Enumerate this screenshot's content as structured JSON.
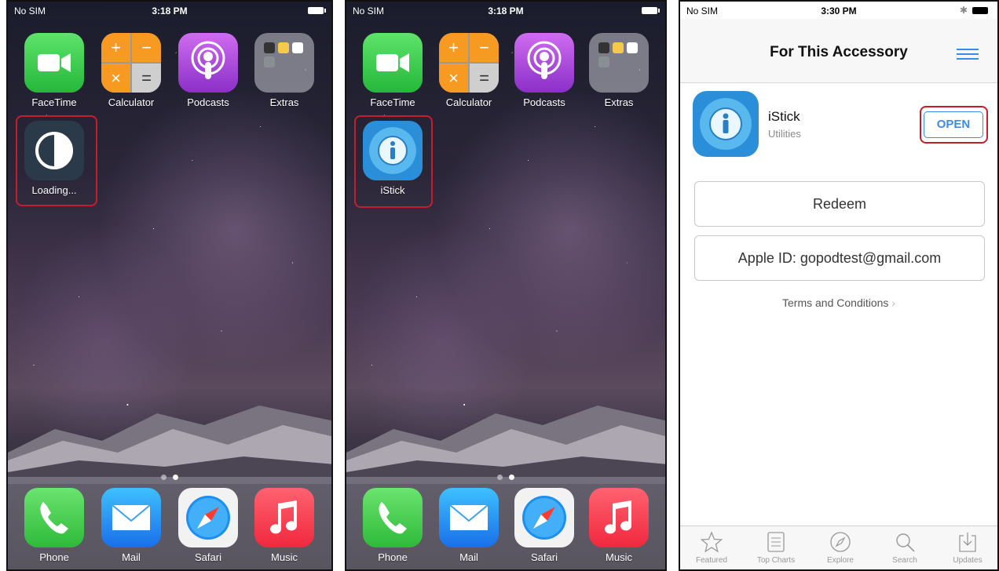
{
  "panel1": {
    "status": {
      "carrier": "No SIM",
      "time": "3:18 PM"
    },
    "apps": [
      {
        "label": "FaceTime"
      },
      {
        "label": "Calculator"
      },
      {
        "label": "Podcasts"
      },
      {
        "label": "Extras"
      }
    ],
    "installing_app": {
      "label": "Loading..."
    },
    "dock": [
      {
        "label": "Phone"
      },
      {
        "label": "Mail"
      },
      {
        "label": "Safari"
      },
      {
        "label": "Music"
      }
    ],
    "page_count": 2,
    "current_page": 2
  },
  "panel2": {
    "status": {
      "carrier": "No SIM",
      "time": "3:18 PM"
    },
    "apps": [
      {
        "label": "FaceTime"
      },
      {
        "label": "Calculator"
      },
      {
        "label": "Podcasts"
      },
      {
        "label": "Extras"
      }
    ],
    "installed_app": {
      "label": "iStick"
    },
    "dock": [
      {
        "label": "Phone"
      },
      {
        "label": "Mail"
      },
      {
        "label": "Safari"
      },
      {
        "label": "Music"
      }
    ],
    "page_count": 2,
    "current_page": 2
  },
  "panel3": {
    "status": {
      "carrier": "No SIM",
      "time": "3:30 PM"
    },
    "nav_title": "For This Accessory",
    "app": {
      "name": "iStick",
      "category": "Utilities",
      "action": "OPEN"
    },
    "redeem_label": "Redeem",
    "apple_id_label": "Apple ID: gopodtest@gmail.com",
    "terms_label": "Terms and Conditions",
    "tabs": [
      {
        "label": "Featured",
        "icon": "star-icon"
      },
      {
        "label": "Top Charts",
        "icon": "list-icon"
      },
      {
        "label": "Explore",
        "icon": "compass-icon"
      },
      {
        "label": "Search",
        "icon": "search-icon"
      },
      {
        "label": "Updates",
        "icon": "download-icon"
      }
    ]
  },
  "colors": {
    "highlight": "#c41e2e",
    "ios_blue": "#3a8be8"
  }
}
